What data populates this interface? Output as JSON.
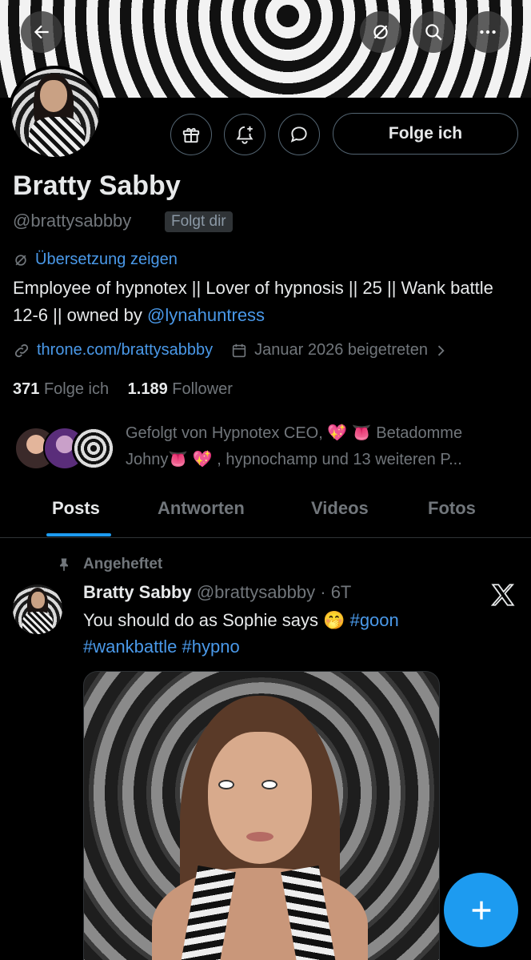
{
  "profile": {
    "name": "Bratty Sabby",
    "handle": "@brattysabbby",
    "follows_you": "Folgt dir",
    "translate_label": "Übersetzung zeigen",
    "bio_text": "Employee of hypnotex || Lover of hypnosis || 25 || Wank battle 12-6 || owned by ",
    "bio_mention": "@lynahuntress",
    "link": "throne.com/brattysabbby",
    "joined": "Januar 2026 beigetreten",
    "following_count": "371",
    "following_label": "Folge ich",
    "followers_count": "1.189",
    "followers_label": "Follower",
    "followed_by_line1": "Gefolgt von Hypnotex CEO, 💖 👅 Betadomme",
    "followed_by_line2": "Johny👅 💖 , hypnochamp und 13 weiteren P..."
  },
  "actions": {
    "follow_label": "Folge ich"
  },
  "tabs": [
    {
      "label": "Posts",
      "active": true
    },
    {
      "label": "Antworten",
      "active": false
    },
    {
      "label": "Videos",
      "active": false
    },
    {
      "label": "Fotos",
      "active": false
    }
  ],
  "post": {
    "pinned_label": "Angeheftet",
    "author": "Bratty Sabby",
    "handle_time": "@brattysabbby · 6T",
    "text": "You should do as Sophie says 🤭 ",
    "tag1": "#goon",
    "tags2": "#wankbattle #hypno"
  },
  "icons": [
    "back-arrow-icon",
    "translate-off-icon",
    "search-icon",
    "more-icon",
    "gift-icon",
    "bell-plus-icon",
    "message-icon",
    "link-icon",
    "calendar-icon",
    "chevron-right-icon",
    "pin-icon",
    "x-logo-icon",
    "plus-icon"
  ],
  "colors": {
    "accent": "#1d9bf0",
    "link": "#4a99e9",
    "muted": "#71767b",
    "text": "#e7e9ea",
    "background": "#000000"
  }
}
